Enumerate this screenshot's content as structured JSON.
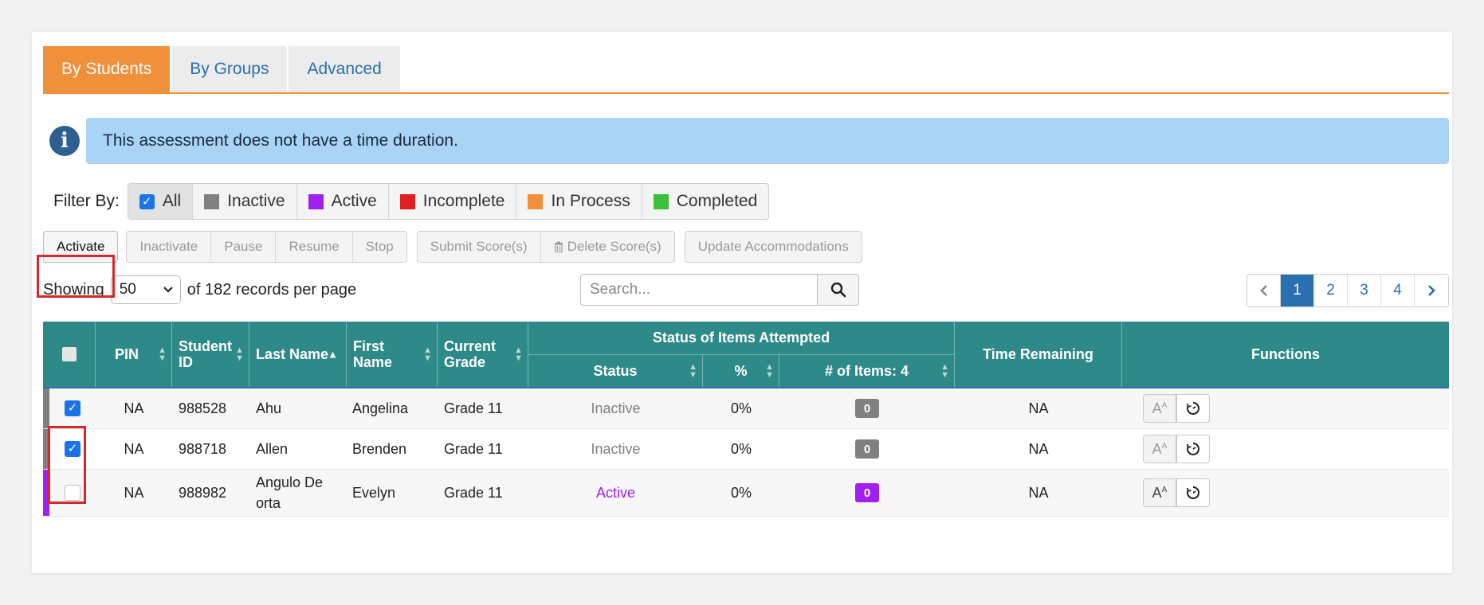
{
  "tabs": [
    "By Students",
    "By Groups",
    "Advanced"
  ],
  "info": {
    "message": "This assessment does not have a time duration."
  },
  "filter": {
    "label": "Filter By:",
    "items": [
      {
        "label": "All",
        "color": "#1a73e8"
      },
      {
        "label": "Inactive",
        "color": "#808080"
      },
      {
        "label": "Active",
        "color": "#a020f0"
      },
      {
        "label": "Incomplete",
        "color": "#e02020"
      },
      {
        "label": "In Process",
        "color": "#f0903a"
      },
      {
        "label": "Completed",
        "color": "#3cbf3c"
      }
    ]
  },
  "actions": {
    "activate": "Activate",
    "inactivate": "Inactivate",
    "pause": "Pause",
    "resume": "Resume",
    "stop": "Stop",
    "submit": "Submit Score(s)",
    "delete": "Delete Score(s)",
    "accommodations": "Update Accommodations"
  },
  "paging": {
    "showing": "Showing",
    "page_size": "50",
    "records_text": "of 182 records per page",
    "search_placeholder": "Search...",
    "pages": [
      "1",
      "2",
      "3",
      "4"
    ],
    "current_page": "1"
  },
  "table": {
    "headers": {
      "pin": "PIN",
      "student_id": "Student ID",
      "last_name": "Last Name",
      "first_name": "First Name",
      "grade": "Current Grade",
      "status_group": "Status of Items Attempted",
      "status": "Status",
      "percent": "%",
      "items": "# of Items: 4",
      "time": "Time Remaining",
      "functions": "Functions"
    },
    "rows": [
      {
        "checked": true,
        "pin": "NA",
        "student_id": "988528",
        "last_name": "Ahu",
        "first_name": "Angelina",
        "grade": "Grade 11",
        "status": "Inactive",
        "percent": "0%",
        "items": "0",
        "time": "NA",
        "color": "#808080"
      },
      {
        "checked": true,
        "pin": "NA",
        "student_id": "988718",
        "last_name": "Allen",
        "first_name": "Brenden",
        "grade": "Grade 11",
        "status": "Inactive",
        "percent": "0%",
        "items": "0",
        "time": "NA",
        "color": "#808080"
      },
      {
        "checked": false,
        "pin": "NA",
        "student_id": "988982",
        "last_name": "Angulo De orta",
        "first_name": "Evelyn",
        "grade": "Grade 11",
        "status": "Active",
        "percent": "0%",
        "items": "0",
        "time": "NA",
        "color": "#a020f0"
      }
    ]
  }
}
